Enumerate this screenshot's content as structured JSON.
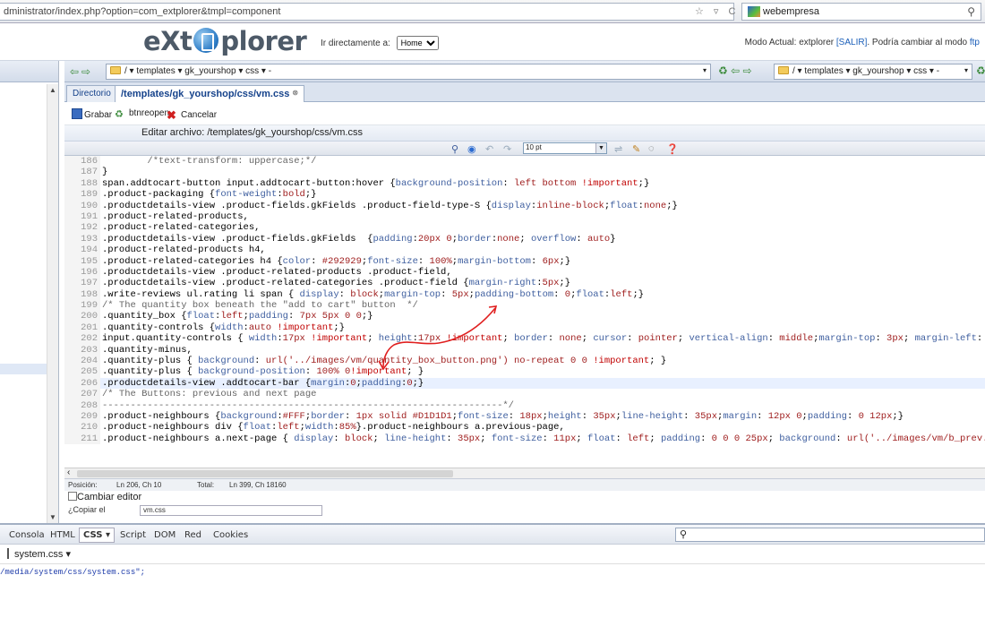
{
  "browser": {
    "url": "dministrator/index.php?option=com_extplorer&tmpl=component",
    "url_controls": "☆ ▿ C",
    "search_engine": "webempresa"
  },
  "header": {
    "logo_left": "eXt",
    "logo_right": "plorer",
    "goto_label": "Ir directamente a:",
    "goto_value": "Home",
    "mode_text": "Modo Actual: extplorer",
    "logout": "[SALIR]",
    "mode_switch": ". Podría cambiar al modo",
    "ftp": "ftp"
  },
  "pathbar": {
    "left_path": "/ ▾  templates ▾  gk_yourshop ▾  css ▾  -",
    "right_path": "/ ▾  templates ▾  gk_yourshop ▾  css ▾  -"
  },
  "tabs": [
    {
      "label": "Directorio"
    },
    {
      "label": "/templates/gk_yourshop/css/vm.css"
    }
  ],
  "editor": {
    "save": "Grabar",
    "reopen": "btnreopen",
    "cancel": "Cancelar",
    "edit_label": "Editar archivo: /templates/gk_yourshop/css/vm.css",
    "font_size": "10 pt",
    "lines": [
      {
        "n": "186",
        "t": "        /*text-transform: uppercase;*/"
      },
      {
        "n": "187",
        "t": "}"
      },
      {
        "n": "188",
        "t": "span.addtocart-button input.addtocart-button:hover {background-position: left bottom !important;}"
      },
      {
        "n": "189",
        "t": ".product-packaging {font-weight:bold;}"
      },
      {
        "n": "190",
        "t": ".productdetails-view .product-fields.gkFields .product-field-type-S {display:inline-block;float:none;}"
      },
      {
        "n": "191",
        "t": ".product-related-products,"
      },
      {
        "n": "192",
        "t": ".product-related-categories,"
      },
      {
        "n": "193",
        "t": ".productdetails-view .product-fields.gkFields  {padding:20px 0;border:none; overflow: auto}"
      },
      {
        "n": "194",
        "t": ".product-related-products h4,"
      },
      {
        "n": "195",
        "t": ".product-related-categories h4 {color: #292929;font-size: 100%;margin-bottom: 6px;}"
      },
      {
        "n": "196",
        "t": ".productdetails-view .product-related-products .product-field,"
      },
      {
        "n": "197",
        "t": ".productdetails-view .product-related-categories .product-field {margin-right:5px;}"
      },
      {
        "n": "198",
        "t": ".write-reviews ul.rating li span { display: block;margin-top: 5px;padding-bottom: 0;float:left;}"
      },
      {
        "n": "199",
        "t": "/* The quantity box beneath the \"add to cart\" button  */"
      },
      {
        "n": "200",
        "t": ".quantity_box {float:left;padding: 7px 5px 0 0;}"
      },
      {
        "n": "201",
        "t": ".quantity-controls {width:auto !important;}"
      },
      {
        "n": "202",
        "t": "input.quantity-controls { width:17px !important; height:17px !important; border: none; cursor: pointer; vertical-align: middle;margin-top: 3px; margin-left: 0"
      },
      {
        "n": "203",
        "t": ".quantity-minus,"
      },
      {
        "n": "204",
        "t": ".quantity-plus { background: url('../images/vm/quantity_box_button.png') no-repeat 0 0 !important; }"
      },
      {
        "n": "205",
        "t": ".quantity-plus { background-position: 100% 0!important; }"
      },
      {
        "n": "206",
        "t": ".productdetails-view .addtocart-bar {margin:0;padding:0;}"
      },
      {
        "n": "207",
        "t": "/* The Buttons: previous and next page"
      },
      {
        "n": "208",
        "t": "-----------------------------------------------------------------------*/"
      },
      {
        "n": "209",
        "t": ".product-neighbours {background:#FFF;border: 1px solid #D1D1D1;font-size: 18px;height: 35px;line-height: 35px;margin: 12px 0;padding: 0 12px;}"
      },
      {
        "n": "210",
        "t": ".product-neighbours div {float:left;width:85%}.product-neighbours a.previous-page,"
      },
      {
        "n": "211",
        "t": ".product-neighbours a.next-page { display: block; line-height: 35px; font-size: 11px; float: left; padding: 0 0 0 25px; background: url('../images/vm/b_prev.p"
      }
    ],
    "status_pos_label": "Posición:",
    "status_pos": "Ln 206, Ch 10",
    "status_total_label": "Total:",
    "status_total": "Ln 399, Ch 18160",
    "change_editor": "Cambiar editor",
    "copy_label": "¿Copiar el",
    "copy_value": "vm.css"
  },
  "firebug": {
    "tabs": [
      "Consola",
      "HTML",
      "CSS ▾",
      "Script",
      "DOM",
      "Red",
      "Cookies"
    ],
    "file": "system.css ▾",
    "line": "/media/system/css/system.css\";"
  },
  "colors": {
    "accent": "#15428b",
    "annotation": "#e02020"
  }
}
